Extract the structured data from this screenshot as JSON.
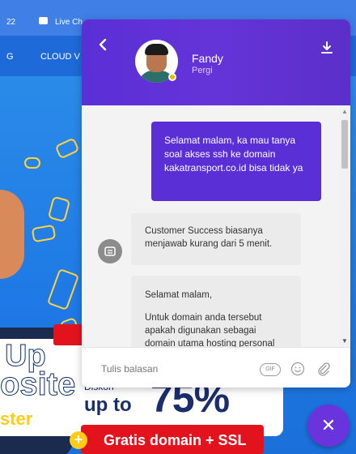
{
  "background_site": {
    "topbar_number": "22",
    "topbar_live_label": "Live Ch",
    "nav_letter": "G",
    "nav_item": "CLOUD V",
    "hero_big_up": "Up",
    "hero_big_site": "osite",
    "hero_big_ster": "ster",
    "promo_diskon": "Diskon",
    "promo_up_to": "up to",
    "promo_percent": "75%",
    "promo_bar_text": "Gratis domain + SSL",
    "promo_plus": "+"
  },
  "chat": {
    "agent": {
      "name": "Fandy",
      "status": "Pergi",
      "status_color": "#f4b400"
    },
    "header_colors": {
      "primary": "#5b2fd6"
    },
    "messages": [
      {
        "from": "user",
        "text": "Selamat malam, ka mau tanya soal akses ssh ke domain kakatransport.co.id bisa tidak ya"
      },
      {
        "from": "bot",
        "text": "Customer Success biasanya menjawab kurang dari 5 menit."
      },
      {
        "from": "agent",
        "paragraphs": [
          "Selamat malam,",
          "Untuk domain anda tersebut apakah digunakan sebagai domain utama hosting personal"
        ]
      }
    ],
    "input": {
      "placeholder": "Tulis balasan",
      "value": ""
    },
    "gif_label": "GIF",
    "icons": {
      "back": "chevron-left-icon",
      "download": "download-icon",
      "bot": "bot-chat-icon",
      "emoji": "smiley-icon",
      "attach": "paperclip-icon",
      "close": "close-icon"
    },
    "close_symbol": "✕"
  }
}
